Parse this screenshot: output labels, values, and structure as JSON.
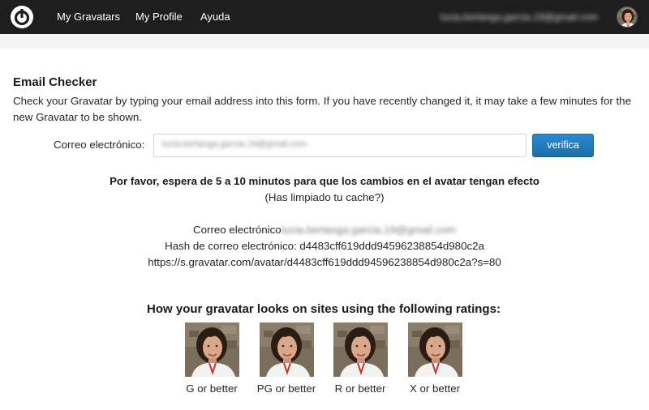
{
  "nav": {
    "items": [
      "My Gravatars",
      "My Profile",
      "Ayuda"
    ],
    "user_email": "lucia.berlanga.garcia.19@gmail.com"
  },
  "checker": {
    "title": "Email Checker",
    "description": "Check your Gravatar by typing your email address into this form. If you have recently changed it, it may take a few minutes for the new Gravatar to be shown.",
    "field_label": "Correo electrónico:",
    "field_value": "lucia.berlanga.garcia.19@gmail.com",
    "button_label": "verifica"
  },
  "result": {
    "wait_message": "Por favor, espera de 5 a 10 minutos para que los cambios en el avatar tengan efecto",
    "cache_message": "(Has limpiado tu cache?)",
    "email_label": "Correo electrónico",
    "email_value": "lucia.berlanga.garcia.19@gmail.com",
    "hash_line": "Hash de correo electrónico: d4483cff619ddd94596238854d980c2a",
    "url_line": "https://s.gravatar.com/avatar/d4483cff619ddd94596238854d980c2a?s=80"
  },
  "ratings": {
    "title": "How your gravatar looks on sites using the following ratings:",
    "items": [
      "G or better",
      "PG or better",
      "R or better",
      "X or better"
    ]
  },
  "colors": {
    "topbar": "#1e1e1e",
    "button": "#1a6ea8"
  },
  "icons": {
    "logo": "gravatar-power-logo",
    "avatar": "user-avatar-photo"
  }
}
